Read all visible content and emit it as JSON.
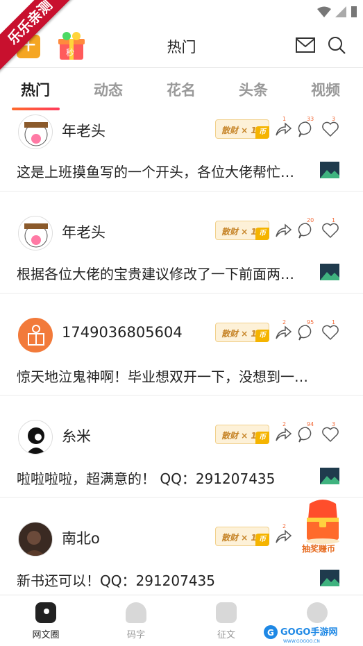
{
  "ribbon": {
    "text": "乐乐亲测"
  },
  "header": {
    "title": "热门",
    "add_label": "+",
    "seckill_label": "秒"
  },
  "tabs": [
    {
      "label": "热门",
      "active": true
    },
    {
      "label": "动态",
      "active": false
    },
    {
      "label": "花名",
      "active": false
    },
    {
      "label": "头条",
      "active": false
    },
    {
      "label": "视频",
      "active": false
    }
  ],
  "posts": [
    {
      "username": "年老头",
      "reward": "散财 × 15",
      "share_count": "1",
      "comment_count": "33",
      "like_count": "3",
      "text": "这是上班摸鱼写的一个开头，各位大佬帮忙…"
    },
    {
      "username": "年老头",
      "reward": "散财 × 15",
      "share_count": "",
      "comment_count": "20",
      "like_count": "1",
      "text": "根据各位大佬的宝贵建议修改了一下前面两…"
    },
    {
      "username": "1749036805604",
      "reward": "散财 × 152",
      "share_count": "2",
      "comment_count": "95",
      "like_count": "1",
      "text": "惊天地泣鬼神啊！毕业想双开一下，没想到一…"
    },
    {
      "username": "糸米",
      "reward": "散财 × 168",
      "share_count": "2",
      "comment_count": "94",
      "like_count": "3",
      "text": "啦啦啦啦，超满意的！ QQ：291207435"
    },
    {
      "username": "南北o",
      "reward": "散财 × 171",
      "share_count": "2",
      "comment_count": "",
      "like_count": "",
      "text": "新书还可以！QQ：291207435"
    }
  ],
  "reward_coin_label": "币",
  "prize": {
    "label": "抽奖赚币"
  },
  "bottom_nav": [
    {
      "label": "网文圈",
      "active": true
    },
    {
      "label": "码字",
      "active": false
    },
    {
      "label": "征文",
      "active": false
    },
    {
      "label": "",
      "active": false
    }
  ],
  "watermark": {
    "text": "GOGO手游网",
    "url": "WWW.GOGOO.CN"
  },
  "colors": {
    "accent": "#ff5a2c",
    "ribbon": "#c8102e",
    "reward_bg": "#fdf1d8",
    "reward_text": "#c7862b"
  }
}
